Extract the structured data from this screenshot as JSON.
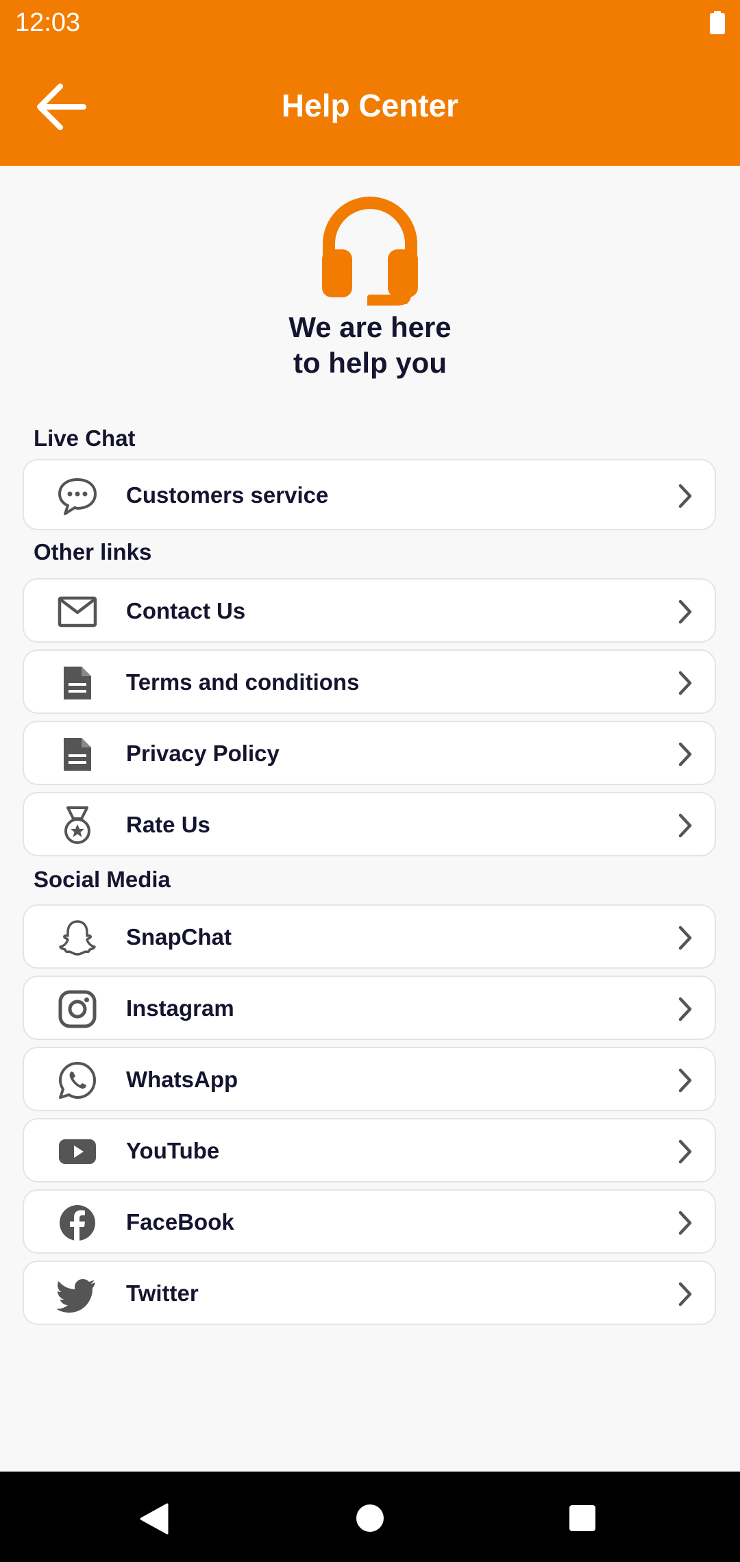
{
  "status_bar": {
    "time": "12:03"
  },
  "app_bar": {
    "title": "Help Center"
  },
  "hero": {
    "line1": "We are here",
    "line2": "to help you"
  },
  "colors": {
    "accent": "#f27c02",
    "text": "#15152f",
    "icon": "#555555"
  },
  "sections": {
    "live_chat": {
      "title": "Live Chat",
      "items": [
        {
          "label": "Customers service",
          "icon": "chat-icon"
        }
      ]
    },
    "other_links": {
      "title": "Other links",
      "items": [
        {
          "label": "Contact Us",
          "icon": "mail-icon"
        },
        {
          "label": "Terms and conditions",
          "icon": "document-icon"
        },
        {
          "label": "Privacy Policy",
          "icon": "document-icon"
        },
        {
          "label": "Rate Us",
          "icon": "medal-icon"
        }
      ]
    },
    "social_media": {
      "title": "Social Media",
      "items": [
        {
          "label": "SnapChat",
          "icon": "snapchat-icon"
        },
        {
          "label": "Instagram",
          "icon": "instagram-icon"
        },
        {
          "label": "WhatsApp",
          "icon": "whatsapp-icon"
        },
        {
          "label": "YouTube",
          "icon": "youtube-icon"
        },
        {
          "label": "FaceBook",
          "icon": "facebook-icon"
        },
        {
          "label": "Twitter",
          "icon": "twitter-icon"
        }
      ]
    }
  }
}
